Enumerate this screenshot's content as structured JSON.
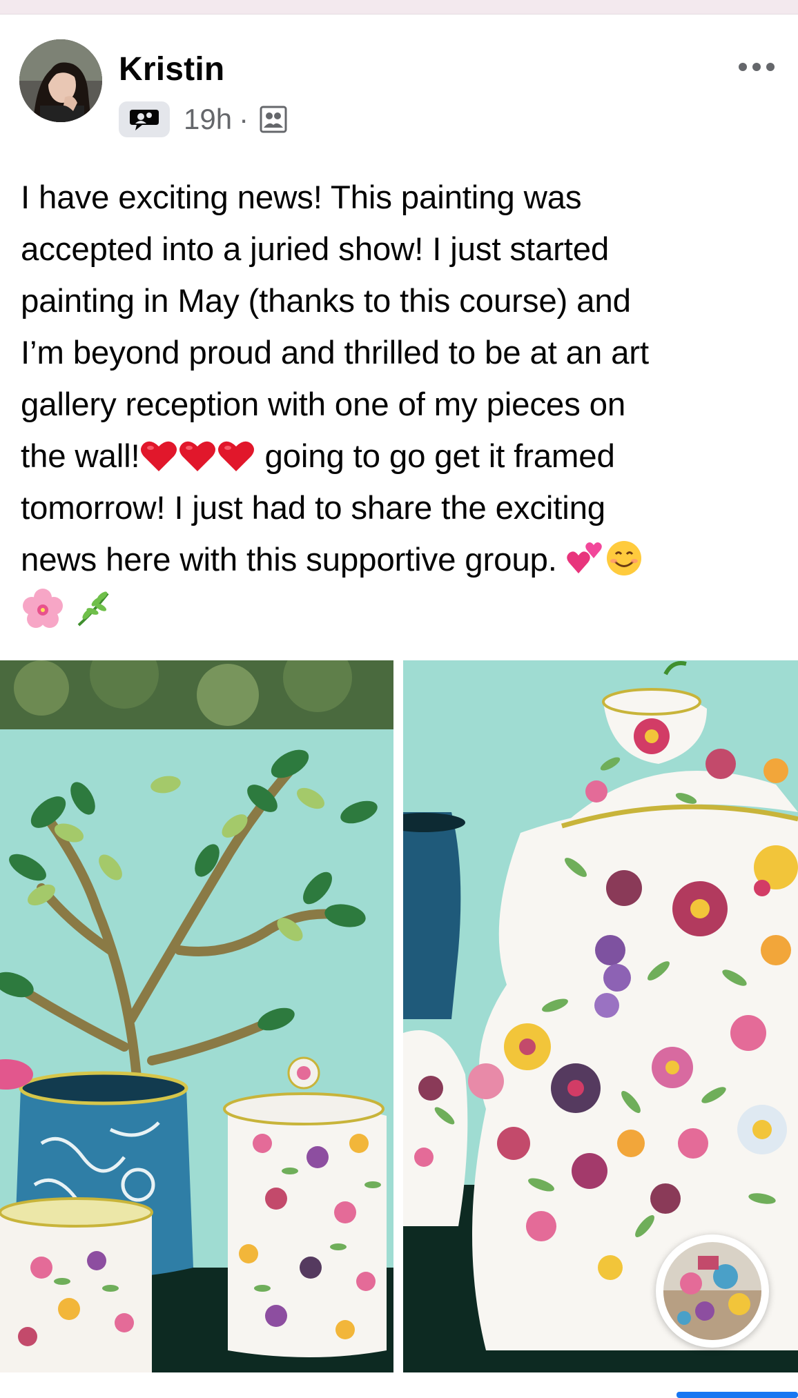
{
  "post": {
    "author": "Kristin",
    "time": "19h",
    "separator": "·",
    "text_lines": [
      "I have exciting news! This painting was",
      "accepted into a juried show! I just started",
      "painting in May (thanks to this course) and",
      "I’m beyond proud and thrilled to be at an art",
      "gallery reception with one of my pieces on",
      "the wall!",
      " going to go get it framed",
      "tomorrow! I just had to share the exciting",
      "news here with this supportive group. "
    ],
    "emojis": {
      "hearts": [
        "red-heart",
        "red-heart",
        "red-heart"
      ],
      "line9_end": [
        "two-hearts",
        "smiling-face"
      ],
      "line10": [
        "cherry-blossom",
        "herb"
      ]
    },
    "icons": {
      "group": "group-chat-icon",
      "audience": "members-icon",
      "more": "more-options-icon"
    }
  },
  "photos": [
    {
      "name": "painting-full-view"
    },
    {
      "name": "painting-teapot-detail"
    }
  ],
  "colors": {
    "accent": "#1877f2",
    "secondary_text": "#65676b",
    "badge_bg": "#e4e6eb"
  }
}
